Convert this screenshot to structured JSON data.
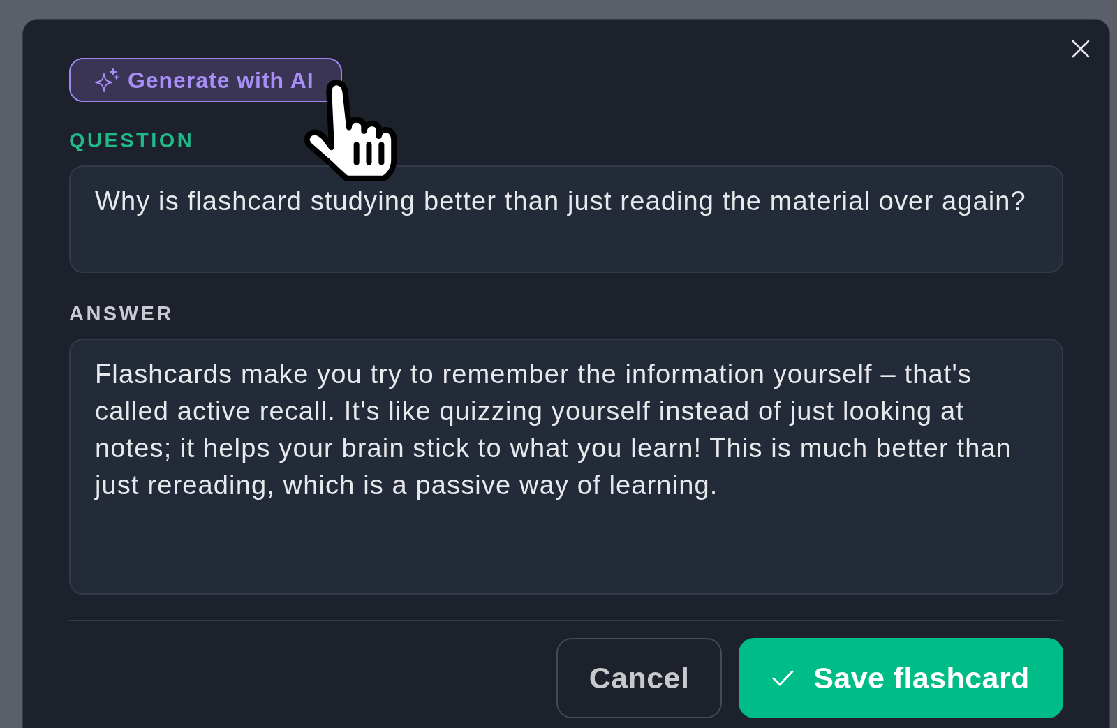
{
  "generate_button": {
    "label": "Generate with AI"
  },
  "fields": [
    {
      "kind": "question",
      "label": "QUESTION",
      "value": "Why is flashcard studying better than just reading the material over again?"
    },
    {
      "kind": "answer",
      "label": "ANSWER",
      "value": "Flashcards make you try to remember the information yourself – that's called active recall. It's like quizzing yourself instead of just looking at notes; it helps your brain stick to what you learn! This is much better than just rereading, which is a passive way of learning."
    }
  ],
  "buttons": [
    {
      "kind": "secondary",
      "label": "Cancel"
    },
    {
      "kind": "primary",
      "label": "Save flashcard"
    }
  ]
}
